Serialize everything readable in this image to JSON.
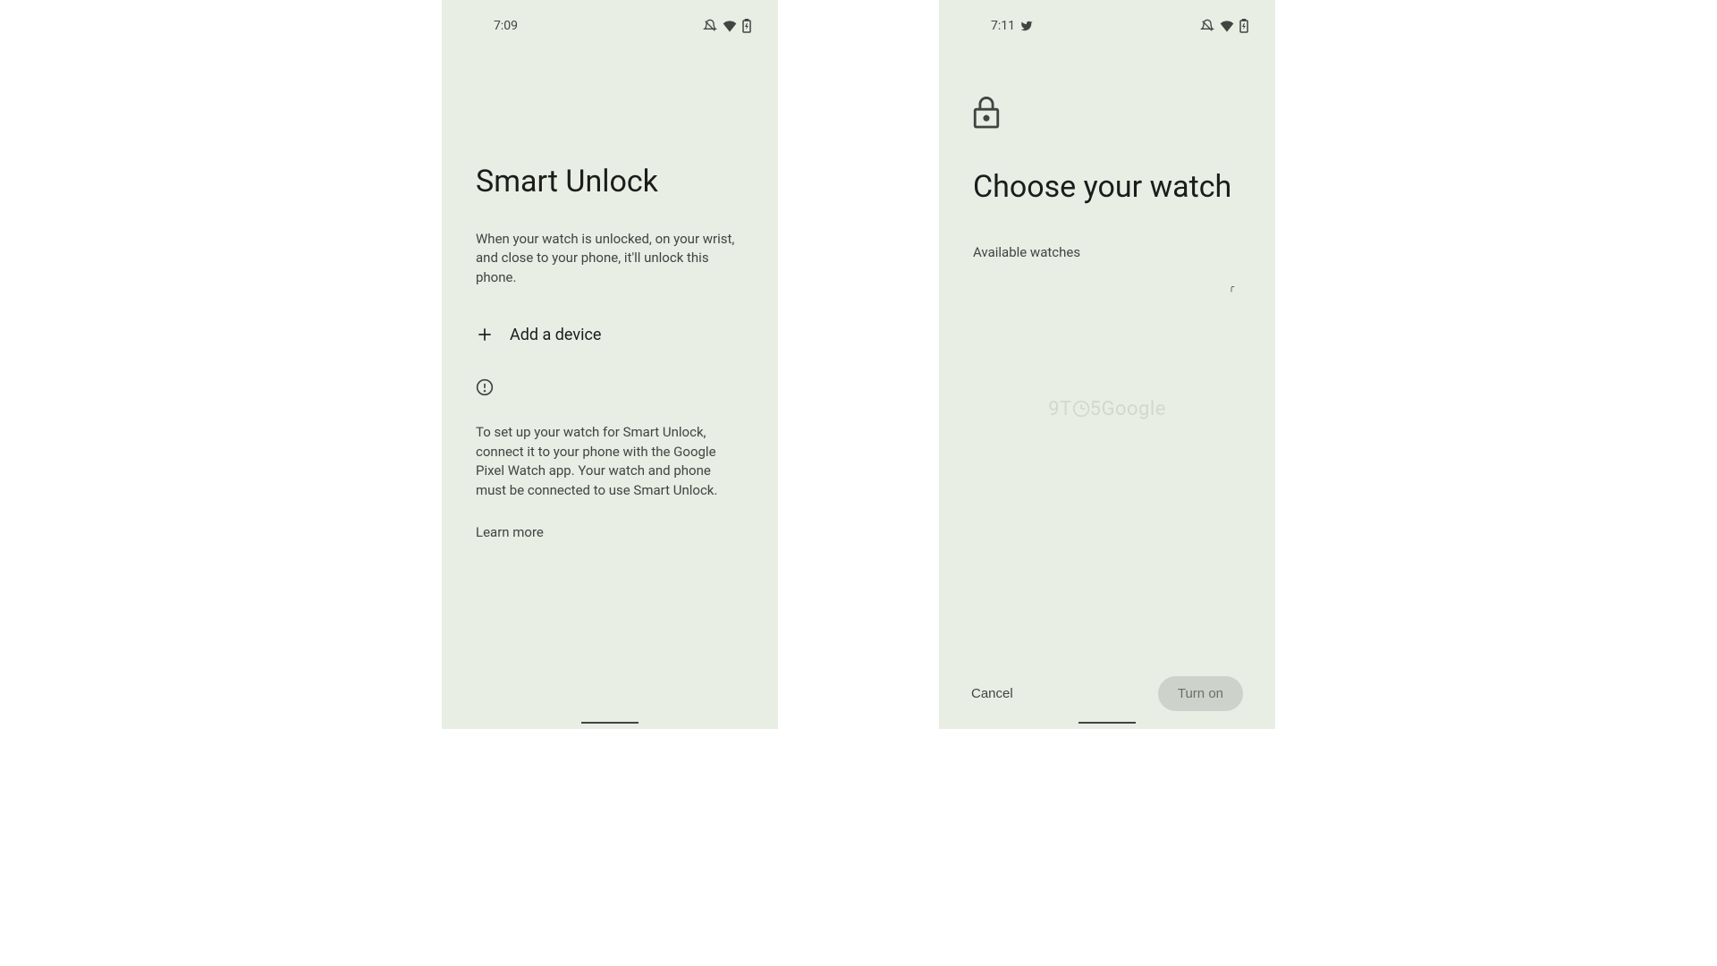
{
  "phone1": {
    "status": {
      "time": "7:09"
    },
    "title": "Smart Unlock",
    "subtitle": "When your watch is unlocked, on your wrist, and close to your phone, it'll unlock this phone.",
    "add_device_label": "Add a device",
    "info_text": "To set up your watch for Smart Unlock, connect it to your phone with the Google Pixel Watch app. Your watch and phone must be connected to use Smart Unlock.",
    "learn_more": "Learn more"
  },
  "phone2": {
    "status": {
      "time": "7:11"
    },
    "title": "Choose your watch",
    "section_label": "Available watches",
    "watermark": "9T⏱5Google",
    "cancel_label": "Cancel",
    "turn_on_label": "Turn on"
  }
}
